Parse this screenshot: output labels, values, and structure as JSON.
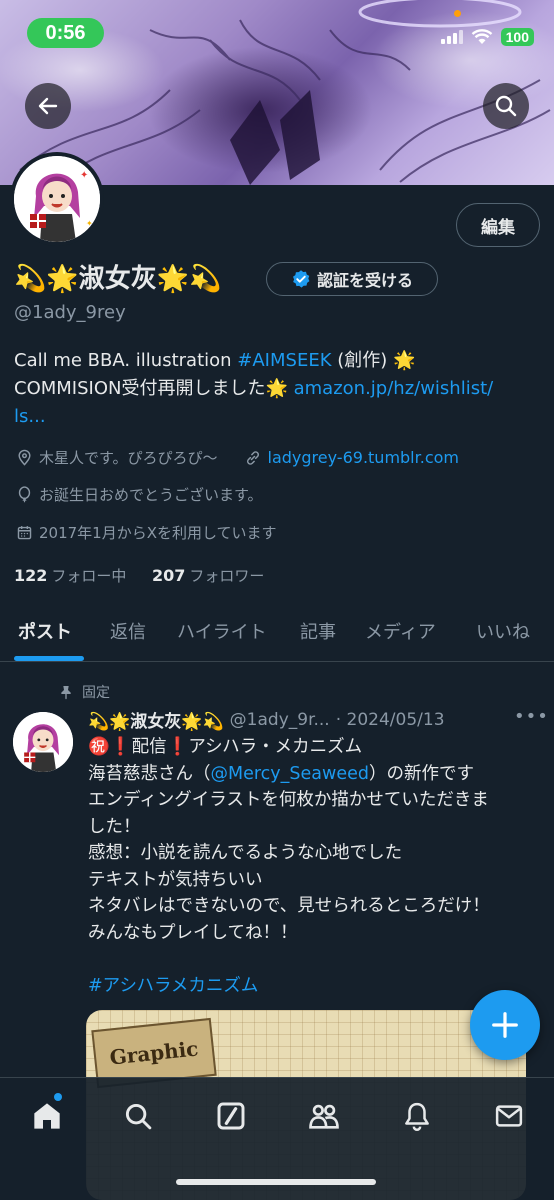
{
  "status_bar": {
    "time": "0:56",
    "battery": "100"
  },
  "profile": {
    "name": "💫🌟淑女灰🌟💫",
    "handle": "@1ady_9rey",
    "edit_label": "編集",
    "verify_label": "認証を受ける",
    "bio_line1_text": "Call me BBA. illustration ",
    "bio_hashtag": "#AIMSEEK",
    "bio_line1_suffix": " (創作) 🌟",
    "bio_line2_text": "COMMISION受付再開しました🌟 ",
    "bio_link": "amazon.jp/hz/wishlist/",
    "bio_link_cont": "ls...",
    "location": "木星人です。ぴろぴろぴ〜",
    "website": "ladygrey-69.tumblr.com",
    "birthday": "お誕生日おめでとうございます。",
    "joined": "2017年1月からXを利用しています",
    "following_count": "122",
    "following_label": "フォロー中",
    "followers_count": "207",
    "followers_label": "フォロワー"
  },
  "tabs": [
    "ポスト",
    "返信",
    "ハイライト",
    "記事",
    "メディア",
    "いいね"
  ],
  "post": {
    "pinned_label": "固定",
    "author_name": "💫🌟淑女灰🌟💫",
    "author_handle": "@1ady_9r...",
    "date": "· 2024/05/13",
    "more": "•••",
    "line1": "㊗️❗️配信❗️アシハラ・メカニズム",
    "line2_pre": "海苔慈悲さん（",
    "line2_mention": "@Mercy_Seaweed",
    "line2_post": "）の新作です",
    "line3": "エンディングイラストを何枚か描かせていただきま",
    "line4": "した！",
    "line5": "感想：小説を読んでるような心地でした",
    "line6": "テキストが気持ちいい",
    "line7": "ネタバレはできないので、見せられるところだけ！",
    "line8": "みんなもプレイしてね！！",
    "hashtag": "#アシハラメカニズム",
    "image_label": "Graphic"
  },
  "colors": {
    "background": "#15202b",
    "accent": "#1d9bf0",
    "text": "#e7e9ea",
    "muted": "#8b98a5",
    "status_green": "#34c759"
  },
  "icons": {
    "back": "arrow-left-icon",
    "search": "search-icon",
    "verified": "verified-badge-icon",
    "location": "location-pin-icon",
    "link": "link-icon",
    "birthday": "balloon-icon",
    "calendar": "calendar-icon",
    "pin": "pin-icon",
    "compose": "plus-icon",
    "nav": [
      "home-icon",
      "search-icon",
      "grok-icon",
      "communities-icon",
      "notifications-icon",
      "messages-icon"
    ]
  }
}
